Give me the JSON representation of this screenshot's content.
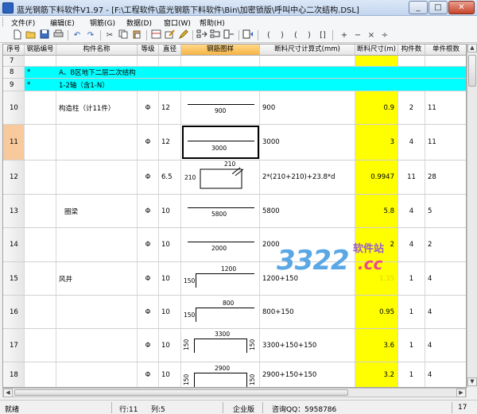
{
  "window": {
    "title": "蓝光钢筋下料软件V1.97 - [F:\\工程软件\\蓝光钢筋下料软件\\Bin\\加密锁版\\呼叫中心二次结构.DSL]",
    "minimize": "_",
    "maximize": "□",
    "close": "✕"
  },
  "menu": [
    {
      "label": "文件(F)"
    },
    {
      "label": "编辑(E)"
    },
    {
      "label": "钢筋(G)"
    },
    {
      "label": "数据(D)"
    },
    {
      "label": "窗口(W)"
    },
    {
      "label": "帮助(H)"
    }
  ],
  "toolbar": {
    "ops": [
      "(",
      ")",
      "(",
      ")",
      "[]",
      "+",
      "−",
      "×",
      "÷"
    ]
  },
  "columns": [
    {
      "label": "序号"
    },
    {
      "label": "钢筋编号"
    },
    {
      "label": "构件名称"
    },
    {
      "label": "等级"
    },
    {
      "label": "直径"
    },
    {
      "label": "钢筋图样"
    },
    {
      "label": "断料尺寸计算式(mm)"
    },
    {
      "label": "断料尺寸(m)"
    },
    {
      "label": "构件数"
    },
    {
      "label": "单件根数"
    }
  ],
  "rows": [
    {
      "no": "7"
    },
    {
      "no": "8",
      "code": "*",
      "name": "A、B区地下二层二次结构"
    },
    {
      "no": "9",
      "code": "*",
      "name": "1-2轴（含1-N）"
    },
    {
      "no": "10",
      "name": "构造柱（计11件）",
      "grade": "Φ",
      "dia": "12",
      "shape_label": "900",
      "formula": "900",
      "len": "0.9",
      "count": "2",
      "per": "11"
    },
    {
      "no": "11",
      "grade": "Φ",
      "dia": "12",
      "shape_label": "3000",
      "formula": "3000",
      "len": "3",
      "count": "4",
      "per": "11"
    },
    {
      "no": "12",
      "grade": "Φ",
      "dia": "6.5",
      "shape_top": "210",
      "shape_left": "210",
      "formula": "2*(210+210)+23.8*d",
      "len": "0.9947",
      "count": "11",
      "per": "28"
    },
    {
      "no": "13",
      "name": "圈梁",
      "grade": "Φ",
      "dia": "10",
      "shape_label": "5800",
      "formula": "5800",
      "len": "5.8",
      "count": "4",
      "per": "5"
    },
    {
      "no": "14",
      "grade": "Φ",
      "dia": "10",
      "shape_label": "2000",
      "formula": "2000",
      "len": "2",
      "count": "4",
      "per": "2"
    },
    {
      "no": "15",
      "name": "风井",
      "grade": "Φ",
      "dia": "10",
      "shape_label": "1200",
      "shape_left": "150",
      "formula": "1200+150",
      "len": "1.35",
      "count": "1",
      "per": "4"
    },
    {
      "no": "16",
      "grade": "Φ",
      "dia": "10",
      "shape_label": "800",
      "shape_left": "150",
      "formula": "800+150",
      "len": "0.95",
      "count": "1",
      "per": "4"
    },
    {
      "no": "17",
      "grade": "Φ",
      "dia": "10",
      "shape_label": "3300",
      "shape_left": "150",
      "shape_right": "150",
      "formula": "3300+150+150",
      "len": "3.6",
      "count": "1",
      "per": "4"
    },
    {
      "no": "18",
      "grade": "Φ",
      "dia": "10",
      "shape_label": "2900",
      "shape_left": "150",
      "shape_right": "150",
      "formula": "2900+150+150",
      "len": "3.2",
      "count": "1",
      "per": "4"
    }
  ],
  "status": {
    "ready": "就绪",
    "row": "行:11",
    "col": "列:5",
    "edition": "企业版",
    "qq": "咨询QQ：5958786",
    "extra": "17"
  },
  "watermark": {
    "num": "3322",
    "site": "软件站",
    "cc": ".cc"
  },
  "colors": {
    "cyan_row": "#00ffff",
    "length_col": "#ffff00",
    "active_header": "#f7b445"
  }
}
